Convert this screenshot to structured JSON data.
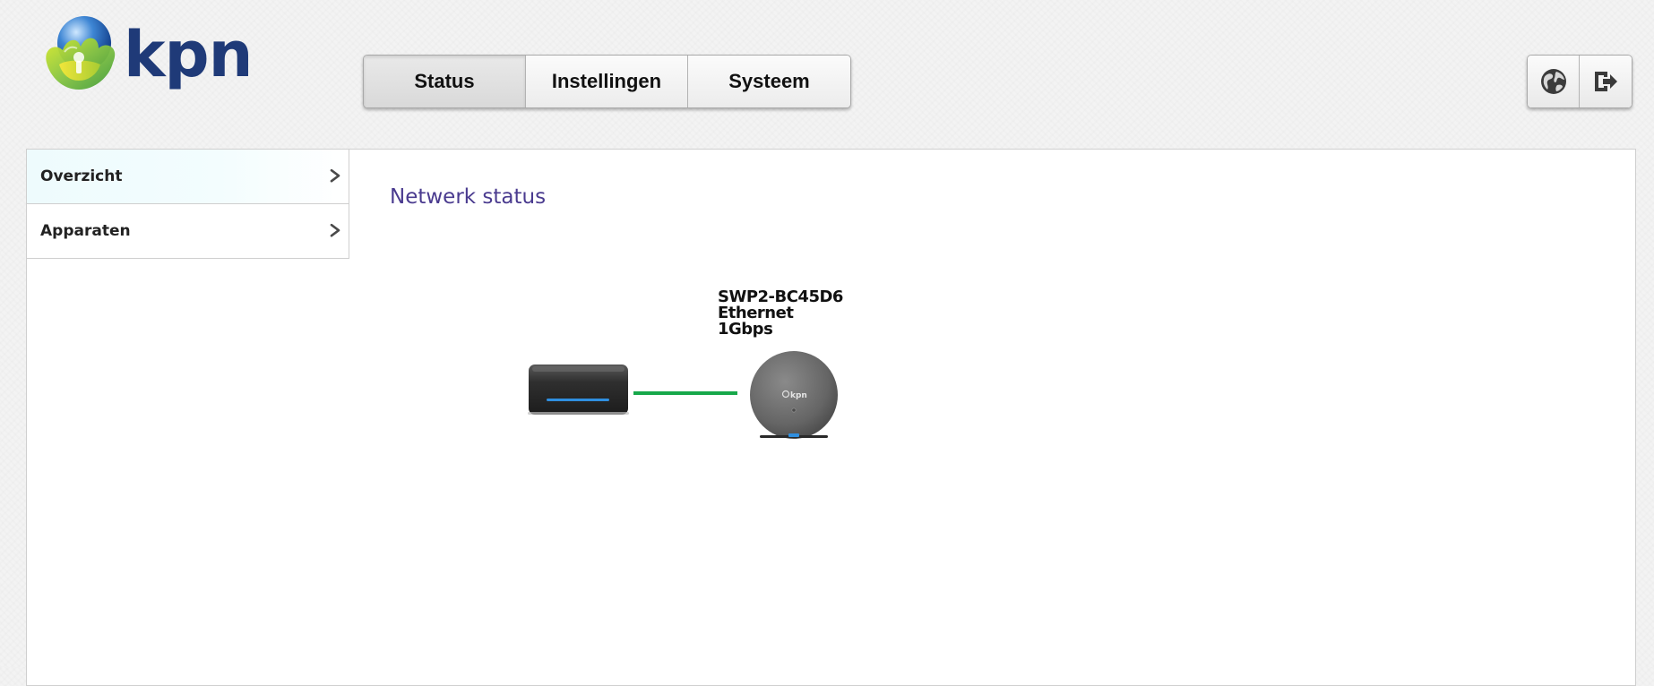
{
  "brand": {
    "name": "kpn",
    "colors": {
      "brand_blue": "#1f3a78",
      "accent_green": "#17a84a",
      "title_purple": "#4a3b8f"
    }
  },
  "top_nav": {
    "tabs": [
      {
        "label": "Status",
        "active": true
      },
      {
        "label": "Instellingen",
        "active": false
      },
      {
        "label": "Systeem",
        "active": false
      }
    ]
  },
  "tools": {
    "language_icon": "globe-icon",
    "logout_icon": "logout-icon"
  },
  "sidebar": {
    "items": [
      {
        "label": "Overzicht",
        "active": true,
        "icon": "chevron-right-icon"
      },
      {
        "label": "Apparaten",
        "active": false,
        "icon": "chevron-right-icon"
      }
    ]
  },
  "main": {
    "title": "Netwerk status",
    "device": {
      "name": "SWP2-BC45D6",
      "connection": "Ethernet",
      "speed": "1Gbps",
      "pod_logo": "kpn"
    }
  }
}
